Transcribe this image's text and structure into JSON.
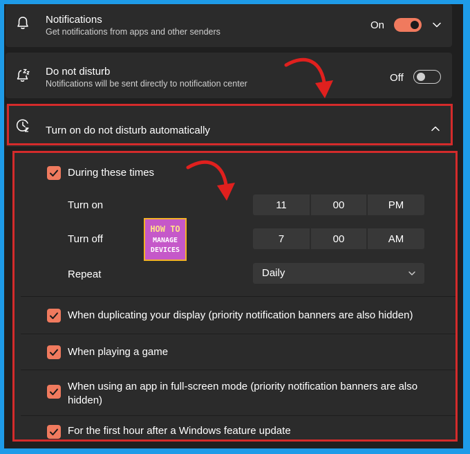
{
  "notifications": {
    "title": "Notifications",
    "subtitle": "Get notifications from apps and other senders",
    "state": "On",
    "icon": "bell-icon"
  },
  "dnd": {
    "title": "Do not disturb",
    "subtitle": "Notifications will be sent directly to notification center",
    "state": "Off",
    "icon": "bell-zz-icon"
  },
  "auto": {
    "title": "Turn on do not disturb automatically",
    "icon": "clock-icon"
  },
  "schedule": {
    "during_label": "During these times",
    "turn_on_label": "Turn on",
    "turn_on": {
      "hour": "11",
      "minute": "00",
      "ampm": "PM"
    },
    "turn_off_label": "Turn off",
    "turn_off": {
      "hour": "7",
      "minute": "00",
      "ampm": "AM"
    },
    "repeat_label": "Repeat",
    "repeat_value": "Daily"
  },
  "options": [
    {
      "line1": "When duplicating your display (priority notification banners are also hidden)"
    },
    {
      "line1": "When playing a game"
    },
    {
      "line1": "When using an app in full-screen mode (priority notification banners are also",
      "line2": "hidden)"
    },
    {
      "line1": "For the first hour after a Windows feature update"
    }
  ],
  "watermark": {
    "line1": "HOW TO",
    "line2": "MANAGE",
    "line3": "DEVICES"
  },
  "colors": {
    "accent": "#f07a5e",
    "highlight": "#d42b2b",
    "background": "#1e9be8"
  }
}
